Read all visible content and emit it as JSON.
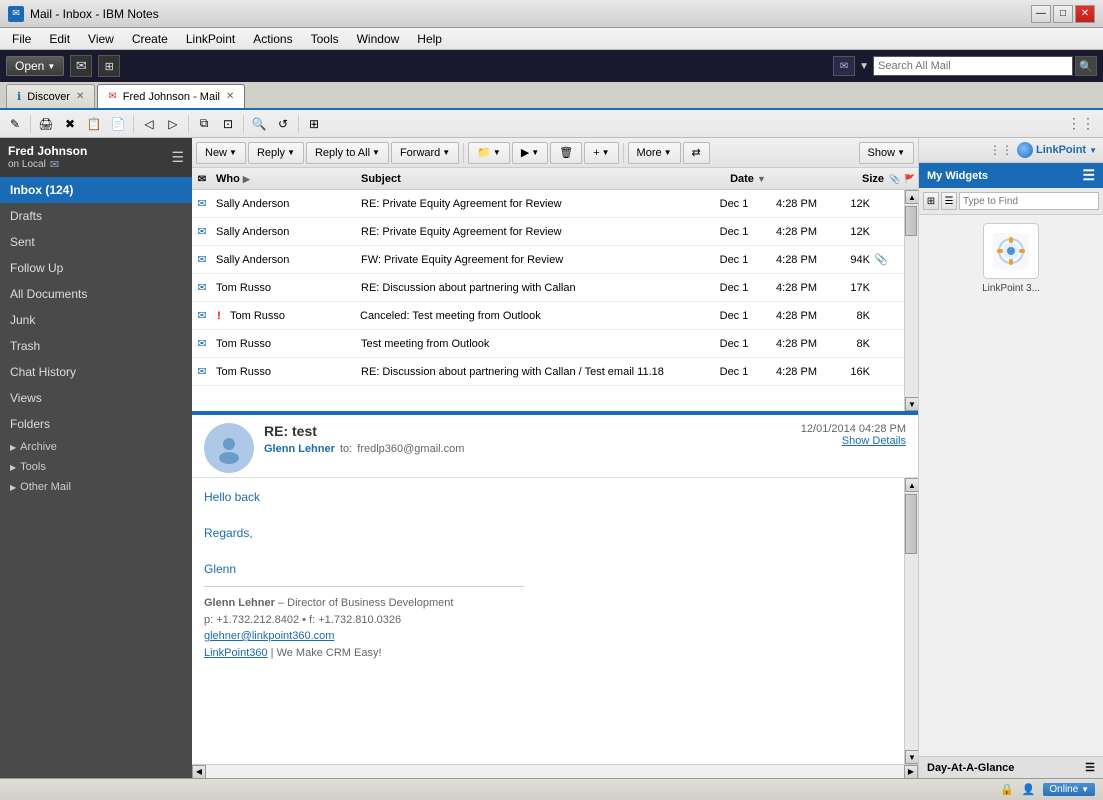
{
  "titleBar": {
    "title": "Mail - Inbox - IBM Notes",
    "icon": "✉",
    "controls": [
      "—",
      "□",
      "✕"
    ]
  },
  "menuBar": {
    "items": [
      "File",
      "Edit",
      "View",
      "Create",
      "LinkPoint",
      "Actions",
      "Tools",
      "Window",
      "Help"
    ]
  },
  "topToolbar": {
    "openLabel": "Open",
    "buttons": [
      "✉",
      "⊞"
    ]
  },
  "searchBar": {
    "placeholder": "Search All Mail",
    "icon": "🔍"
  },
  "tabs": [
    {
      "label": "Discover",
      "active": false,
      "closable": true
    },
    {
      "label": "Fred Johnson - Mail",
      "active": true,
      "closable": true
    }
  ],
  "sidebar": {
    "title": "Fred Johnson",
    "subtitle": "on Local",
    "items": [
      {
        "label": "Inbox (124)",
        "active": true,
        "bold": true
      },
      {
        "label": "Drafts"
      },
      {
        "label": "Sent"
      },
      {
        "label": "Follow Up"
      },
      {
        "label": "All Documents"
      },
      {
        "label": "Junk"
      },
      {
        "label": "Trash"
      },
      {
        "label": "Chat History"
      },
      {
        "label": "Views"
      },
      {
        "label": "Folders"
      }
    ],
    "groups": [
      {
        "label": "Archive",
        "expanded": false
      },
      {
        "label": "Tools",
        "expanded": false
      },
      {
        "label": "Other Mail",
        "expanded": false
      }
    ]
  },
  "emailToolbar": {
    "buttons": [
      {
        "label": "New",
        "dropdown": true
      },
      {
        "label": "Reply",
        "dropdown": true
      },
      {
        "label": "Reply to All",
        "dropdown": true
      },
      {
        "label": "Forward",
        "dropdown": true
      },
      {
        "label": "📁",
        "dropdown": true
      },
      {
        "label": "▶",
        "dropdown": true
      },
      {
        "label": "🗑",
        "dropdown": false
      },
      {
        "label": "+",
        "dropdown": true
      },
      {
        "label": "More",
        "dropdown": true
      },
      {
        "label": "⇄",
        "dropdown": false
      },
      {
        "label": "Show",
        "dropdown": true
      }
    ]
  },
  "emailListHeaders": {
    "columns": [
      "",
      "Who",
      "Subject",
      "Date",
      "",
      "Size",
      ""
    ]
  },
  "emails": [
    {
      "id": 1,
      "read": false,
      "flag": "✉",
      "sender": "Sally Anderson",
      "subject": "RE: Private Equity Agreement for Review",
      "date": "Dec 1",
      "time": "4:28 PM",
      "size": "12K",
      "attachment": false,
      "exclaim": false
    },
    {
      "id": 2,
      "read": false,
      "flag": "✉",
      "sender": "Sally Anderson",
      "subject": "RE: Private Equity Agreement for Review",
      "date": "Dec 1",
      "time": "4:28 PM",
      "size": "12K",
      "attachment": false,
      "exclaim": false
    },
    {
      "id": 3,
      "read": false,
      "flag": "✉",
      "sender": "Sally Anderson",
      "subject": "FW: Private Equity Agreement for Review",
      "date": "Dec 1",
      "time": "4:28 PM",
      "size": "94K",
      "attachment": true,
      "exclaim": false
    },
    {
      "id": 4,
      "read": false,
      "flag": "✉",
      "sender": "Tom Russo",
      "subject": "RE: Discussion about partnering with Callan",
      "date": "Dec 1",
      "time": "4:28 PM",
      "size": "17K",
      "attachment": false,
      "exclaim": false
    },
    {
      "id": 5,
      "read": false,
      "flag": "✉",
      "sender": "Tom Russo",
      "subject": "Canceled: Test meeting from Outlook",
      "date": "Dec 1",
      "time": "4:28 PM",
      "size": "8K",
      "attachment": false,
      "exclaim": true
    },
    {
      "id": 6,
      "read": false,
      "flag": "✉",
      "sender": "Tom Russo",
      "subject": "Test meeting from Outlook",
      "date": "Dec 1",
      "time": "4:28 PM",
      "size": "8K",
      "attachment": false,
      "exclaim": false
    },
    {
      "id": 7,
      "read": false,
      "flag": "✉",
      "sender": "Tom Russo",
      "subject": "RE: Discussion about partnering with Callan / Test email 11.18",
      "date": "Dec 1",
      "time": "4:28 PM",
      "size": "16K",
      "attachment": false,
      "exclaim": false
    }
  ],
  "preview": {
    "subject": "RE: test",
    "fromName": "Glenn Lehner",
    "toLabel": "to:",
    "toEmail": "fredlp360@gmail.com",
    "date": "12/01/2014 04:28 PM",
    "showDetails": "Show Details",
    "body": [
      "Hello back",
      "",
      "Regards,",
      "",
      "Glenn"
    ],
    "sig": {
      "name": "Glenn Lehner",
      "title": "– Director of Business Development",
      "phone": "p: +1.732.212.8402  •  f: +1.732.810.0326",
      "email": "glehner@linkpoint360.com",
      "footer": "LinkPoint360 | We Make CRM Easy!"
    }
  },
  "rightPanel": {
    "title": "My Widgets",
    "linkpointLabel": "LinkPoint",
    "typeFindPlaceholder": "Type to Find",
    "widgets": [
      {
        "label": "LinkPoint 3...",
        "icon": "🔗"
      }
    ]
  },
  "dayAtAGlance": {
    "label": "Day-At-A-Glance"
  },
  "statusBar": {
    "left": "",
    "lockIcon": "🔒",
    "personIcon": "👤",
    "onlineLabel": "Online"
  }
}
